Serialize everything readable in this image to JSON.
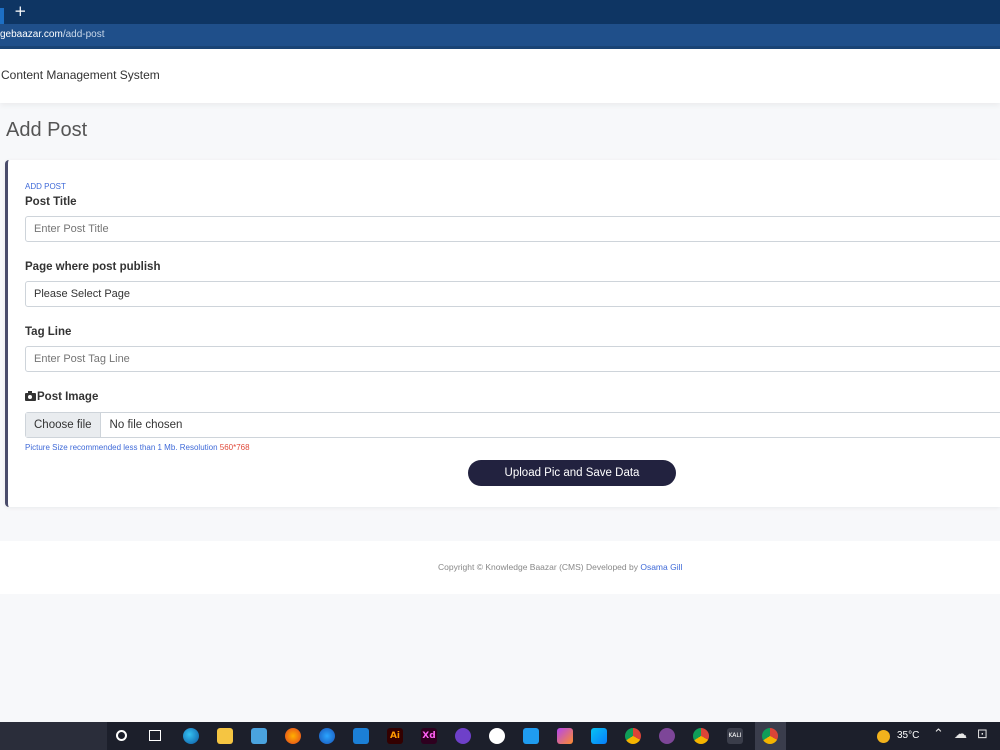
{
  "browser": {
    "new_tab_glyph": "+",
    "url_domain": "gebaazar.com",
    "url_path": "/add-post"
  },
  "navbar": {
    "brand": "Content Management System"
  },
  "page": {
    "title": "Add Post"
  },
  "form": {
    "section_label": "ADD POST",
    "post_title": {
      "label": "Post Title",
      "placeholder": "Enter Post Title"
    },
    "page_select": {
      "label": "Page where post publish",
      "selected": "Please Select Page"
    },
    "tag_line": {
      "label": "Tag Line",
      "placeholder": "Enter Post Tag Line"
    },
    "post_image": {
      "label": "Post Image",
      "choose_button": "Choose file",
      "file_status": "No file chosen"
    },
    "hint_text": "Picture Size recommended less than 1 Mb. Resolution ",
    "hint_resolution": "560*768",
    "submit_label": "Upload Pic and Save Data"
  },
  "footer": {
    "copyright_text": "Copyright © Knowledge Baazar (CMS) Developed by ",
    "developer": "Osama Gill"
  },
  "taskbar": {
    "temperature": "35°C",
    "pinned_apps": [
      "search-icon",
      "task-view-icon",
      "edge-icon",
      "file-explorer-icon",
      "store-icon",
      "firefox-icon",
      "firefox-dev-icon",
      "mail-icon",
      "illustrator-icon",
      "xd-icon",
      "github-icon",
      "word-icon",
      "vscode-icon",
      "phpstorm-icon",
      "webstorm-icon",
      "chrome-icon",
      "tor-icon",
      "chrome-canary-icon",
      "kali-icon",
      "chrome-active-icon"
    ],
    "app_letters": {
      "illustrator": "Ai",
      "xd": "Xd",
      "kali": "KALI"
    }
  },
  "colors": {
    "accent": "#3f6ad8",
    "button": "#22223f",
    "card_border": "#4a4c6b",
    "hint_red": "#e04a3a"
  }
}
